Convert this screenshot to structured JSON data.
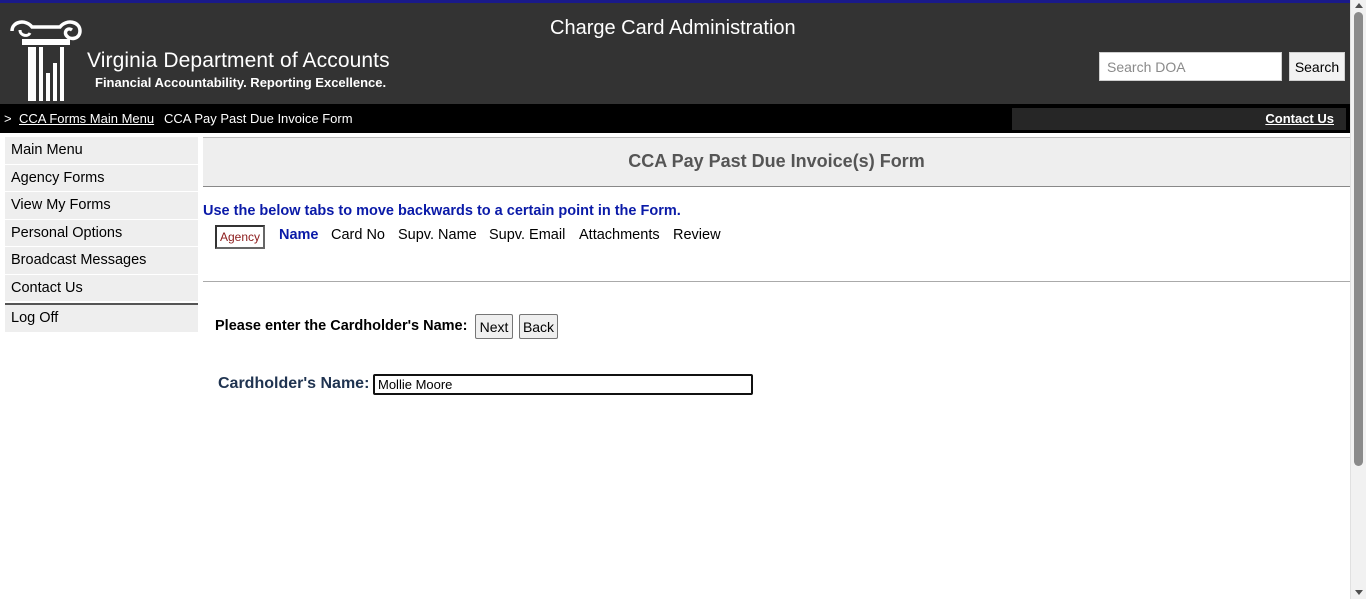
{
  "header": {
    "app_title": "Charge Card Administration",
    "org_name": "Virginia Department of Accounts",
    "tagline": "Financial Accountability. Reporting Excellence.",
    "logo_icon": "column-pillar-icon",
    "search": {
      "placeholder": "Search DOA",
      "value": "",
      "button_label": "Search"
    }
  },
  "breadcrumb": {
    "separator": ">",
    "link_label": "CCA Forms Main Menu",
    "current": "CCA Pay Past Due Invoice Form",
    "contact_label": "Contact Us"
  },
  "sidebar": {
    "items": [
      {
        "label": "Main Menu"
      },
      {
        "label": "Agency Forms"
      },
      {
        "label": "View My Forms"
      },
      {
        "label": "Personal Options"
      },
      {
        "label": "Broadcast Messages"
      },
      {
        "label": "Contact Us"
      }
    ],
    "logoff_label": "Log Off"
  },
  "main": {
    "title": "CCA Pay Past Due Invoice(s) Form",
    "instruction": "Use the below tabs to move backwards to a certain point in the Form.",
    "tabs": [
      {
        "label": "Agency",
        "state": "completed"
      },
      {
        "label": "Name",
        "state": "current"
      },
      {
        "label": "Card No",
        "state": "pending"
      },
      {
        "label": "Supv. Name",
        "state": "pending"
      },
      {
        "label": "Supv. Email",
        "state": "pending"
      },
      {
        "label": "Attachments",
        "state": "pending"
      },
      {
        "label": "Review",
        "state": "pending"
      }
    ],
    "prompt": "Please enter the Cardholder's Name:",
    "next_label": "Next",
    "back_label": "Back",
    "name_field": {
      "label": "Cardholder's Name:",
      "value": "Mollie Moore"
    }
  },
  "colors": {
    "header_bg": "#333333",
    "breadcrumb_bg": "#000000",
    "accent_blue": "#0a1aa8",
    "agency_tab_text": "#8b1a1a"
  }
}
